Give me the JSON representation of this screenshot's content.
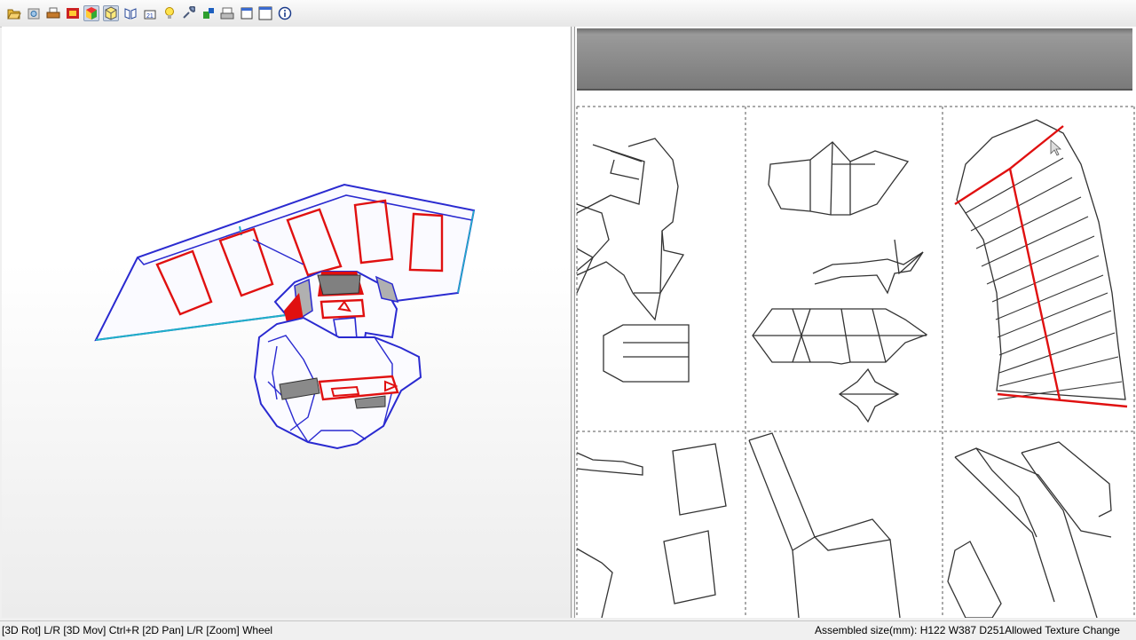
{
  "toolbar": {
    "buttons": [
      {
        "id": "open",
        "icon": "folder-open-icon",
        "pressed": false
      },
      {
        "id": "settings",
        "icon": "gear-box-icon",
        "pressed": false
      },
      {
        "id": "print",
        "icon": "printer-icon",
        "pressed": false
      },
      {
        "id": "texture",
        "icon": "texture-icon",
        "pressed": false
      },
      {
        "id": "view-3d-solid",
        "icon": "cube-solid-icon",
        "pressed": true
      },
      {
        "id": "view-3d-wire",
        "icon": "cube-wire-icon",
        "pressed": true
      },
      {
        "id": "join",
        "icon": "join-faces-icon",
        "pressed": false
      },
      {
        "id": "numbers",
        "icon": "edge-numbers-icon",
        "pressed": false
      },
      {
        "id": "light",
        "icon": "lightbulb-icon",
        "pressed": false
      },
      {
        "id": "tools",
        "icon": "wrench-icon",
        "pressed": false
      },
      {
        "id": "unfold",
        "icon": "unfold-icon",
        "pressed": false
      },
      {
        "id": "printer-setup",
        "icon": "page-setup-icon",
        "pressed": false
      },
      {
        "id": "window-single",
        "icon": "window-single-icon",
        "pressed": false
      },
      {
        "id": "window-full",
        "icon": "window-full-icon",
        "pressed": false
      },
      {
        "id": "info",
        "icon": "info-icon",
        "pressed": false
      }
    ]
  },
  "status": {
    "left": "[3D Rot] L/R [3D Mov] Ctrl+R [2D Pan] L/R [Zoom] Wheel",
    "right": "Assembled size(mm): H122 W387 D251Allowed Texture Change"
  },
  "colors": {
    "outline": "#2a2ad0",
    "fold_red": "#e01010",
    "edge_2d": "#333333",
    "header_gray": "#8c8c8c"
  }
}
